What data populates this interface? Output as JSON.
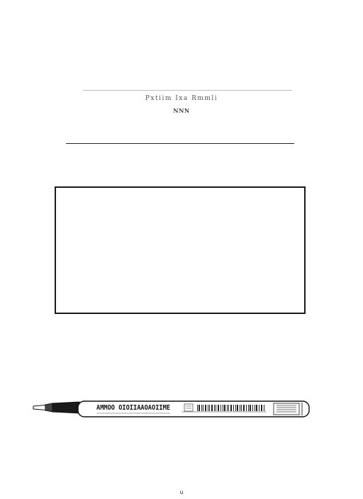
{
  "header": {
    "title": "Pxtiim Ixa Rmmli",
    "subtitle": "NNN"
  },
  "illustration": {
    "pen_print": "AMMOO OIOIIAAOAOIIME",
    "pen_icon_name": "pen-icon"
  },
  "footer": {
    "page_number": "u"
  }
}
